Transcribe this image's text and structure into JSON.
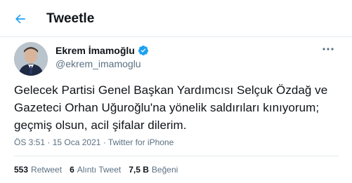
{
  "header": {
    "title": "Tweetle",
    "back_icon": "arrow-left-icon",
    "accent_color": "#1da1f2"
  },
  "author": {
    "name": "Ekrem İmamoğlu",
    "handle": "@ekrem_imamoglu",
    "verified_icon": "verified-badge-icon",
    "more_icon": "more-horizontal-icon"
  },
  "tweet": {
    "text": "Gelecek Partisi Genel Başkan Yardımcısı Selçuk Özdağ ve Gazeteci Orhan Uğuroğlu'na yönelik saldırıları kınıyorum; geçmiş olsun, acil şifalar dilerim.",
    "time": "ÖS 3:51",
    "separator": "·",
    "date": "15 Oca 2021",
    "source": "Twitter for iPhone"
  },
  "stats": {
    "retweets_count": "553",
    "retweets_label": "Retweet",
    "quotes_count": "6",
    "quotes_label": "Alıntı Tweet",
    "likes_count": "7,5 B",
    "likes_label": "Beğeni"
  }
}
